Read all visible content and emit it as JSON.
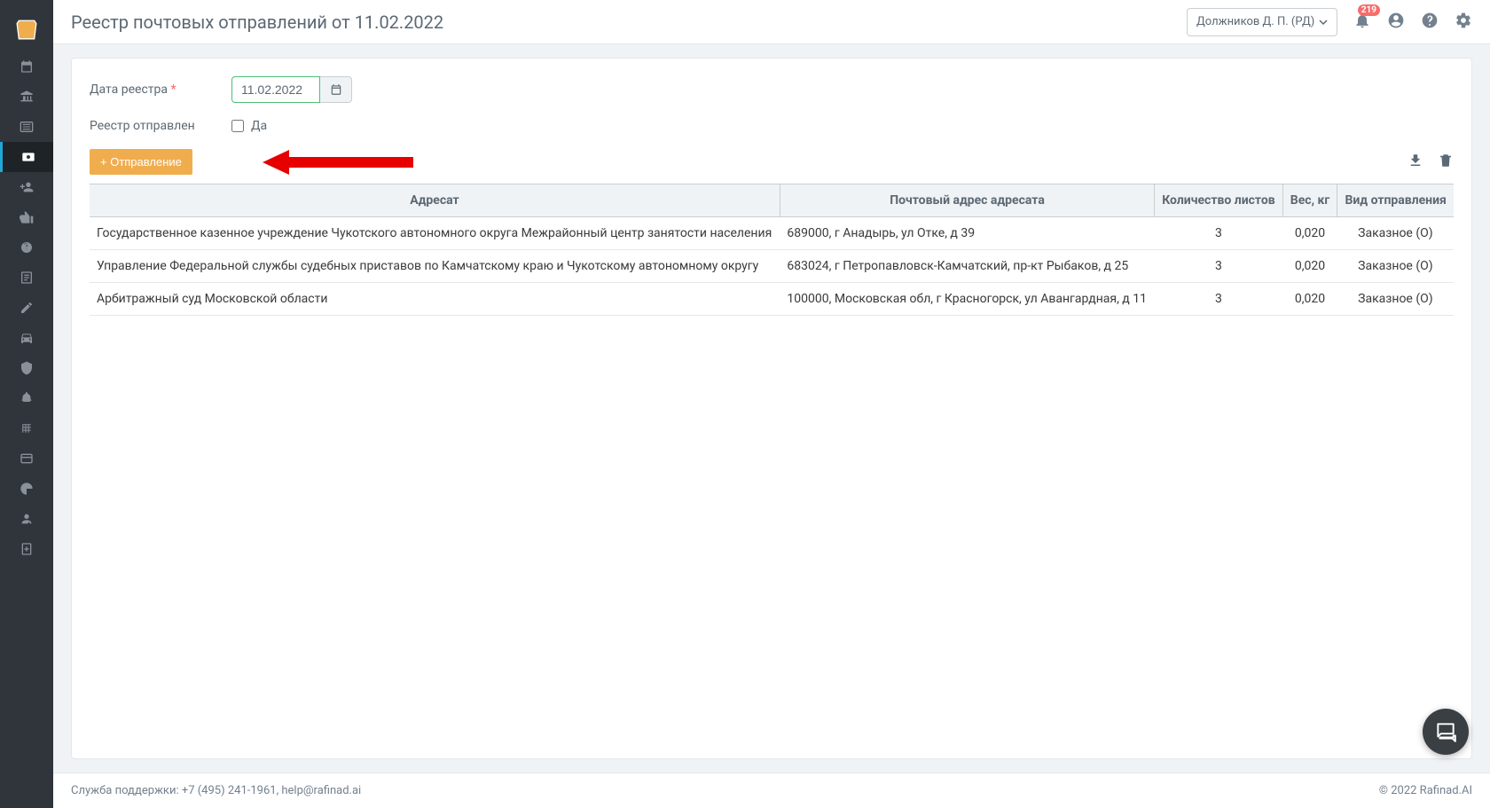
{
  "header": {
    "title": "Реестр почтовых отправлений от 11.02.2022",
    "user_name": "Должников Д. П. (РД)",
    "badge_count": "219"
  },
  "form": {
    "date_label": "Дата реестра",
    "date_value": "11.02.2022",
    "sent_label": "Реестр отправлен",
    "sent_checkbox_label": "Да"
  },
  "actions": {
    "add_label": "+ Отправление"
  },
  "table": {
    "headers": {
      "recipient": "Адресат",
      "address": "Почтовый адрес адресата",
      "sheets": "Количество листов",
      "weight": "Вес, кг",
      "type": "Вид отправления"
    },
    "rows": [
      {
        "recipient": "Государственное казенное учреждение Чукотского автономного округа Межрайонный центр занятости населения",
        "address": "689000, г Анадырь, ул Отке, д 39",
        "sheets": "3",
        "weight": "0,020",
        "type": "Заказное (О)"
      },
      {
        "recipient": "Управление Федеральной службы судебных приставов по Камчатскому краю и Чукотскому автономному округу",
        "address": "683024, г Петропавловск-Камчатский, пр-кт Рыбаков, д 25",
        "sheets": "3",
        "weight": "0,020",
        "type": "Заказное (О)"
      },
      {
        "recipient": "Арбитражный суд Московской области",
        "address": "100000, Московская обл, г Красногорск, ул Авангардная, д 11",
        "sheets": "3",
        "weight": "0,020",
        "type": "Заказное (О)"
      }
    ]
  },
  "footer": {
    "support": "Служба поддержки: +7 (495) 241-1961, help@rafinad.ai",
    "copyright": "© 2022  Rafinad.AI"
  }
}
